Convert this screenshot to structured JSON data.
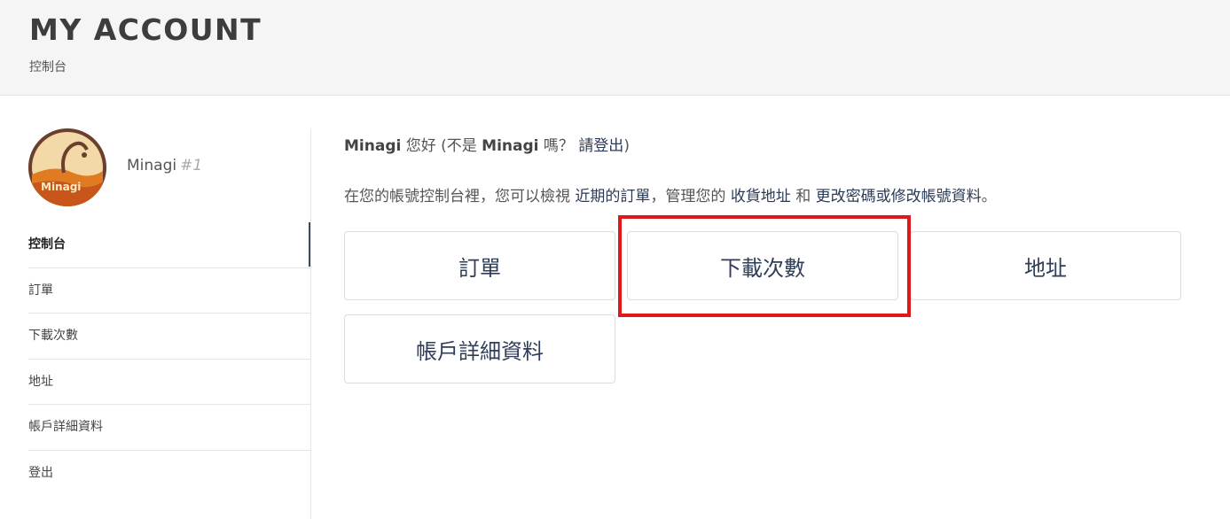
{
  "header": {
    "title": "MY ACCOUNT",
    "subtitle": "控制台"
  },
  "profile": {
    "avatar_text": "Minagi",
    "name": "Minagi",
    "id": "#1"
  },
  "sidebar": {
    "items": [
      {
        "label": "控制台",
        "active": true
      },
      {
        "label": "訂單",
        "active": false
      },
      {
        "label": "下載次數",
        "active": false
      },
      {
        "label": "地址",
        "active": false
      },
      {
        "label": "帳戶詳細資料",
        "active": false
      },
      {
        "label": "登出",
        "active": false
      }
    ]
  },
  "main": {
    "greeting": {
      "name": "Minagi",
      "hello": " 您好 (不是 ",
      "name2": "Minagi",
      "question": " 嗎？ ",
      "logout_link": "請登出",
      "close": ")"
    },
    "intro": {
      "part1": "在您的帳號控制台裡，您可以檢視 ",
      "link_orders": "近期的訂單",
      "part2": "，管理您的 ",
      "link_addresses": "收貨地址",
      "part3": " 和 ",
      "link_account": "更改密碼或修改帳號資料",
      "part4": "。"
    },
    "tiles": [
      {
        "label": "訂單"
      },
      {
        "label": "下載次數"
      },
      {
        "label": "地址"
      },
      {
        "label": "帳戶詳細資料"
      }
    ]
  },
  "colors": {
    "accent": "#3a4a62",
    "highlight": "#e0181a",
    "link": "#2b3a55"
  }
}
